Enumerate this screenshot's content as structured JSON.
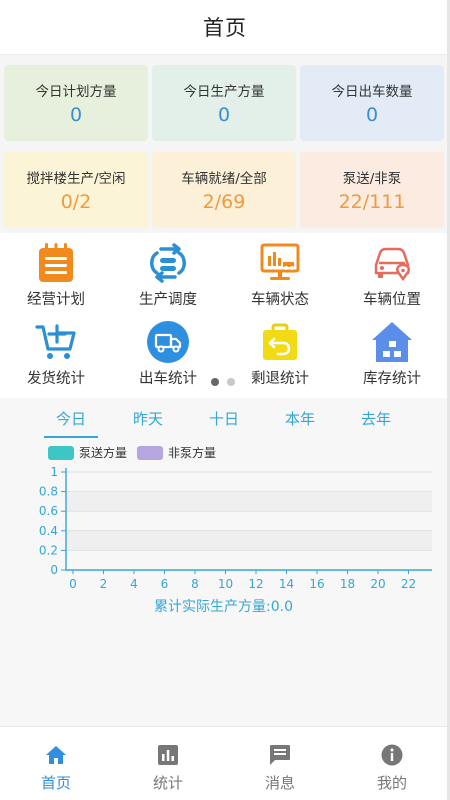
{
  "header": {
    "title": "首页"
  },
  "stats": [
    {
      "label": "今日计划方量",
      "value": "0"
    },
    {
      "label": "今日生产方量",
      "value": "0"
    },
    {
      "label": "今日出车数量",
      "value": "0"
    },
    {
      "label": "搅拌楼生产/空闲",
      "value": "0/2"
    },
    {
      "label": "车辆就绪/全部",
      "value": "2/69"
    },
    {
      "label": "泵送/非泵",
      "value": "22/111"
    }
  ],
  "menu": [
    {
      "label": "经营计划",
      "icon": "plan-icon"
    },
    {
      "label": "生产调度",
      "icon": "dispatch-icon"
    },
    {
      "label": "车辆状态",
      "icon": "vehicle-status-icon"
    },
    {
      "label": "车辆位置",
      "icon": "vehicle-location-icon"
    },
    {
      "label": "发货统计",
      "icon": "cart-icon"
    },
    {
      "label": "出车统计",
      "icon": "truck-icon"
    },
    {
      "label": "剩退统计",
      "icon": "return-icon"
    },
    {
      "label": "库存统计",
      "icon": "warehouse-icon"
    }
  ],
  "chart_tabs": [
    "今日",
    "昨天",
    "十日",
    "本年",
    "去年"
  ],
  "chart_data": {
    "type": "bar",
    "categories": [
      "0",
      "1",
      "2",
      "3",
      "4",
      "5",
      "6",
      "7",
      "8",
      "9",
      "10",
      "11",
      "12",
      "13",
      "14",
      "15",
      "16",
      "17",
      "18",
      "19",
      "20",
      "21",
      "22",
      "23"
    ],
    "series": [
      {
        "name": "泵送方量",
        "values": [
          0,
          0,
          0,
          0,
          0,
          0,
          0,
          0,
          0,
          0,
          0,
          0,
          0,
          0,
          0,
          0,
          0,
          0,
          0,
          0,
          0,
          0,
          0,
          0
        ],
        "color": "#3ec6c6"
      },
      {
        "name": "非泵方量",
        "values": [
          0,
          0,
          0,
          0,
          0,
          0,
          0,
          0,
          0,
          0,
          0,
          0,
          0,
          0,
          0,
          0,
          0,
          0,
          0,
          0,
          0,
          0,
          0,
          0
        ],
        "color": "#b6a6e0"
      }
    ],
    "xticks": [
      "0",
      "2",
      "4",
      "6",
      "8",
      "10",
      "12",
      "14",
      "16",
      "18",
      "20",
      "22"
    ],
    "yticks": [
      "0",
      "0.2",
      "0.4",
      "0.6",
      "0.8",
      "1"
    ],
    "ylim": [
      0,
      1
    ],
    "grid": true,
    "legend": "top-left",
    "caption": "累计实际生产方量:0.0"
  },
  "tabbar": [
    {
      "label": "首页",
      "icon": "home-icon",
      "active": true
    },
    {
      "label": "统计",
      "icon": "stats-icon",
      "active": false
    },
    {
      "label": "消息",
      "icon": "message-icon",
      "active": false
    },
    {
      "label": "我的",
      "icon": "info-icon",
      "active": false
    }
  ],
  "colors": {
    "accent": "#34a6d8",
    "tab_active": "#2e8ee0",
    "value_blue": "#3b8fd0",
    "value_orange": "#f09a3e"
  }
}
